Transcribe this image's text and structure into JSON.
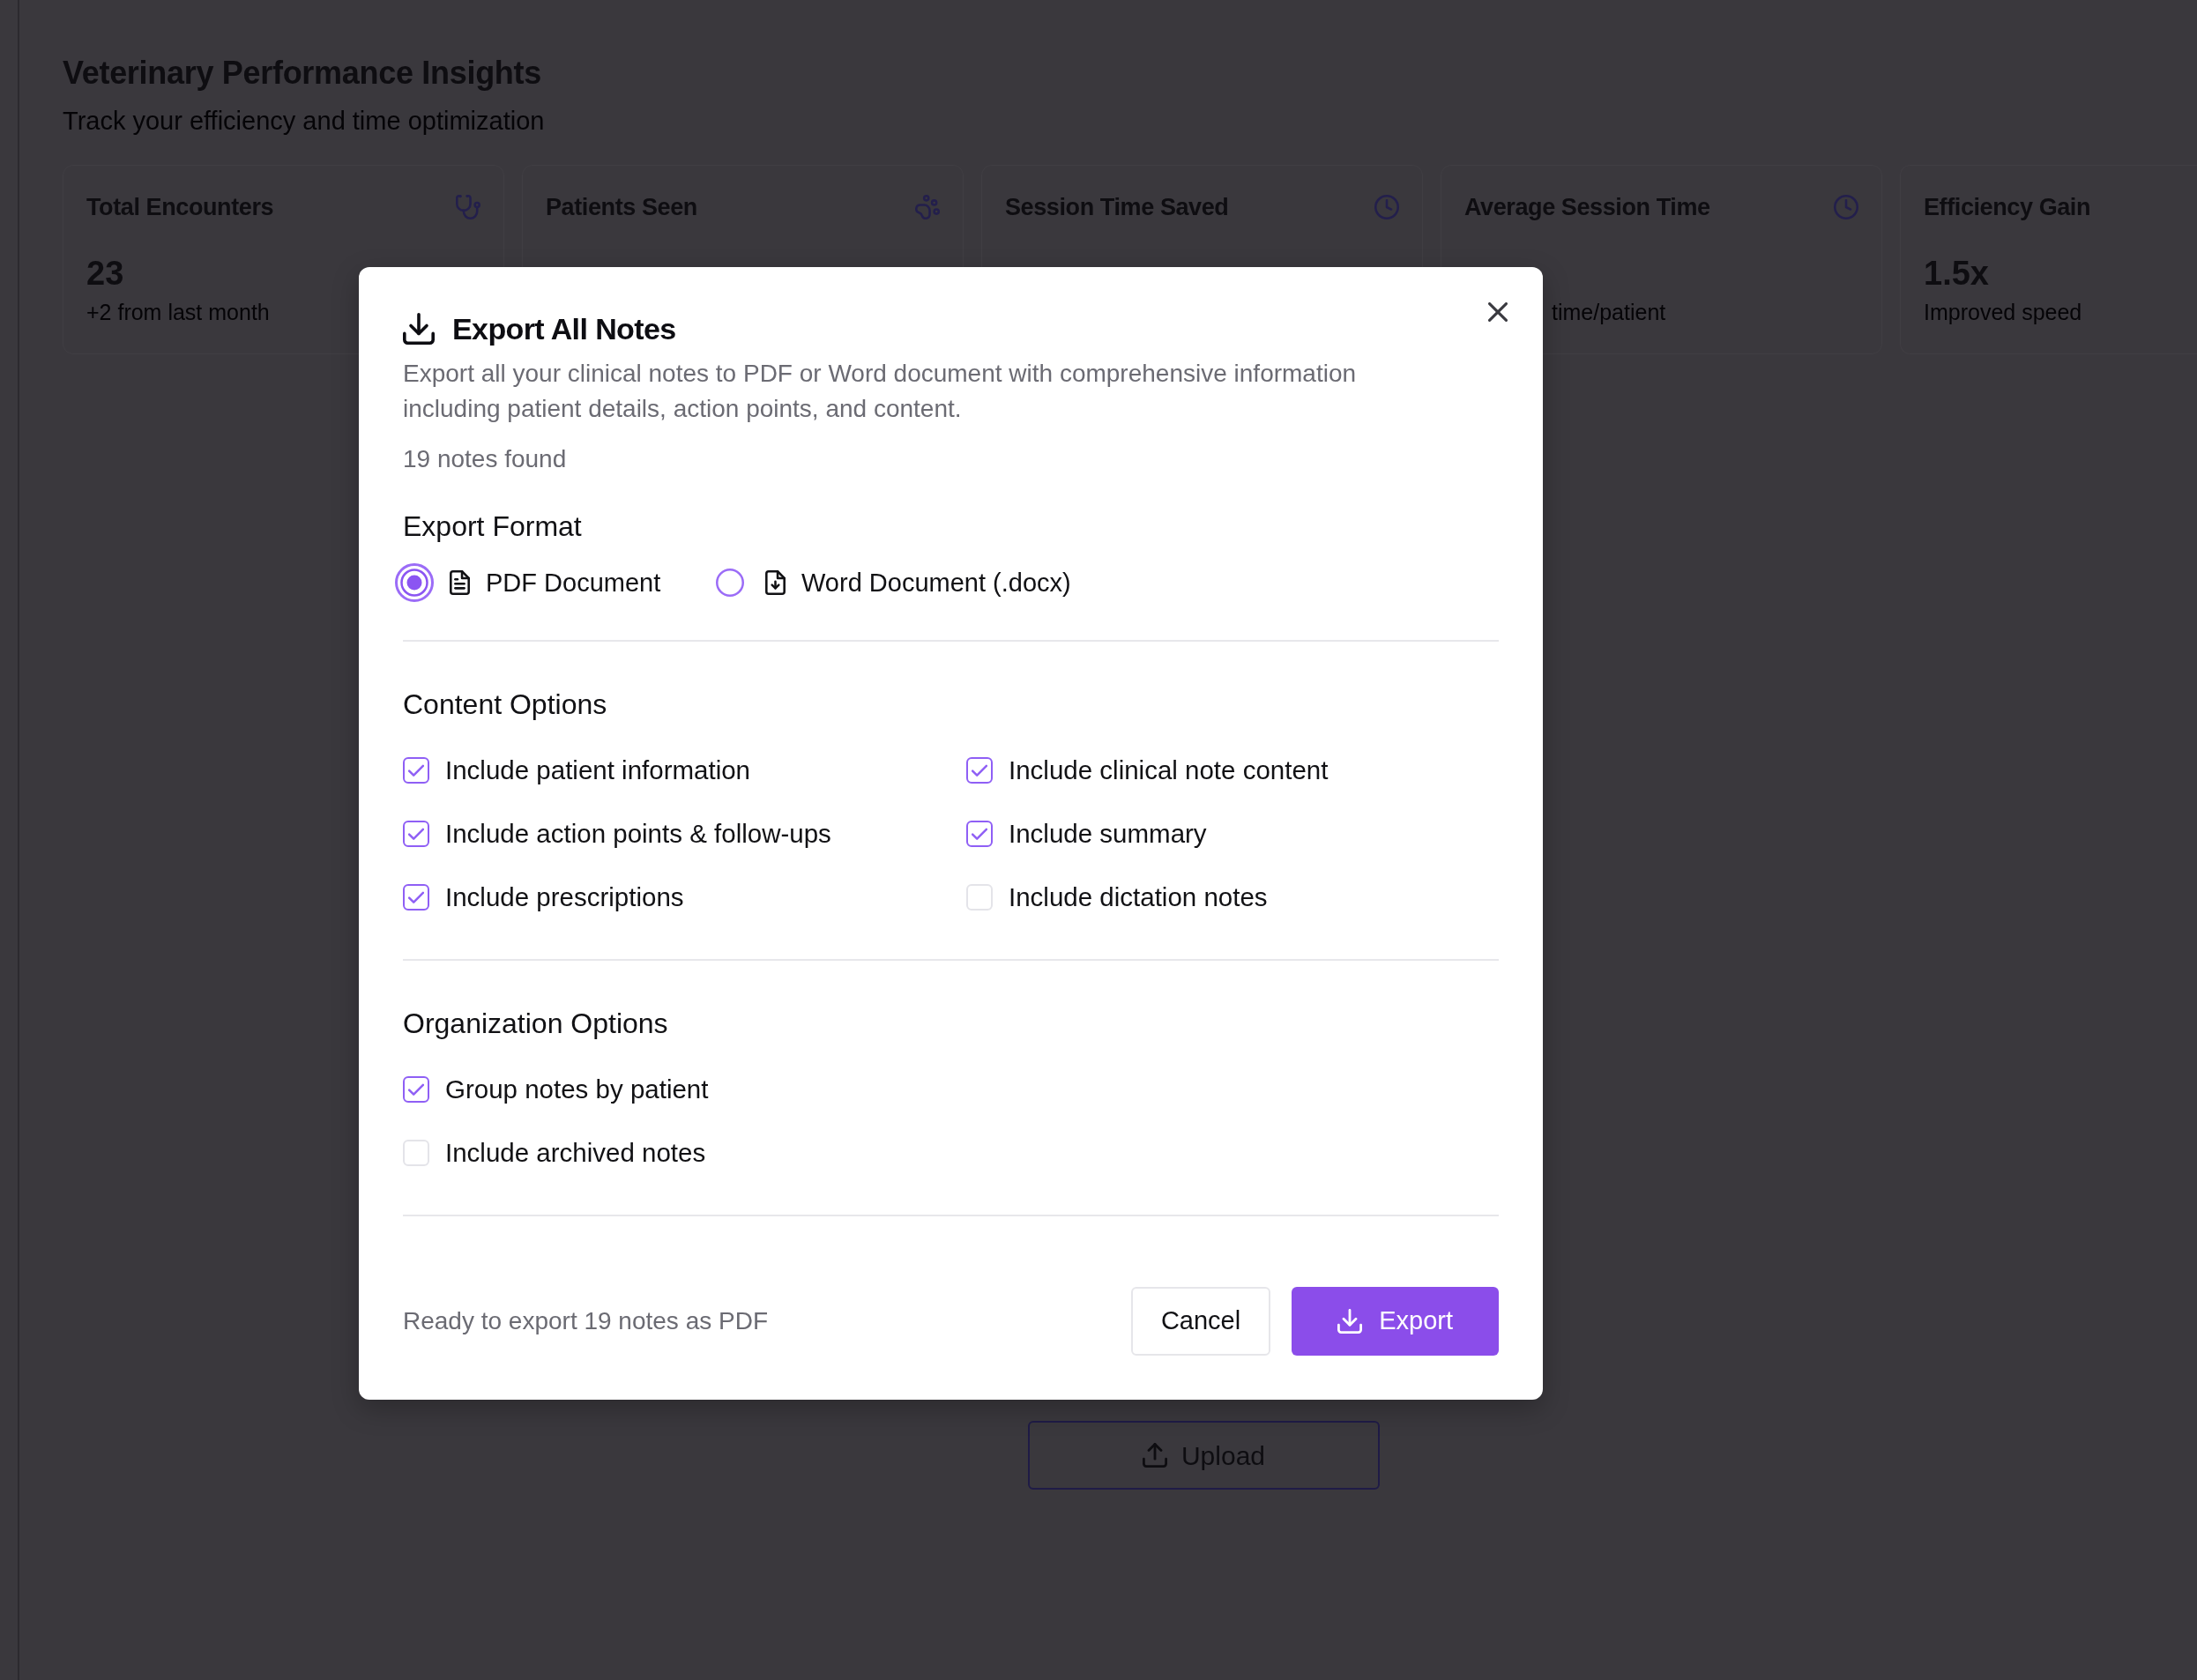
{
  "page": {
    "title": "Veterinary Performance Insights",
    "subtitle": "Track your efficiency and time optimization"
  },
  "stat_cards": [
    {
      "kind": "encounters",
      "label": "Total Encounters",
      "value": "23",
      "note": "+2 from last month"
    },
    {
      "kind": "patients",
      "label": "Patients Seen"
    },
    {
      "kind": "time",
      "label": "Session Time Saved"
    },
    {
      "kind": "time",
      "label": "Average Session Time",
      "note": "time/patient"
    },
    {
      "kind": "efficiency",
      "label": "Efficiency Gain",
      "value": "1.5x",
      "note": "Improved speed"
    }
  ],
  "upload_button": {
    "label": "Upload"
  },
  "dialog": {
    "title": "Export All Notes",
    "description": "Export all your clinical notes to PDF or Word document with comprehensive information including patient details, action points, and content.",
    "count": "19 notes found",
    "sections": [
      {
        "kind": "radio",
        "heading": "Export Format",
        "options": [
          {
            "kind": "pdf",
            "label": "PDF Document",
            "selected": true
          },
          {
            "kind": "word",
            "label": "Word Document (.docx)",
            "selected": false
          }
        ]
      },
      {
        "kind": "checkbox_grid",
        "heading": "Content Options",
        "options": [
          {
            "label": "Include patient information",
            "checked": true
          },
          {
            "label": "Include clinical note content",
            "checked": true
          },
          {
            "label": "Include action points & follow-ups",
            "checked": true
          },
          {
            "label": "Include summary",
            "checked": true
          },
          {
            "label": "Include prescriptions",
            "checked": true
          },
          {
            "label": "Include dictation notes",
            "checked": false
          }
        ]
      },
      {
        "kind": "checkbox_list",
        "heading": "Organization Options",
        "options": [
          {
            "label": "Group notes by patient",
            "checked": true
          },
          {
            "label": "Include archived notes",
            "checked": false
          }
        ]
      }
    ],
    "status": "Ready to export 19 notes as PDF",
    "buttons": [
      {
        "kind": "secondary",
        "label": "Cancel"
      },
      {
        "kind": "primary",
        "label": "Export"
      }
    ]
  }
}
